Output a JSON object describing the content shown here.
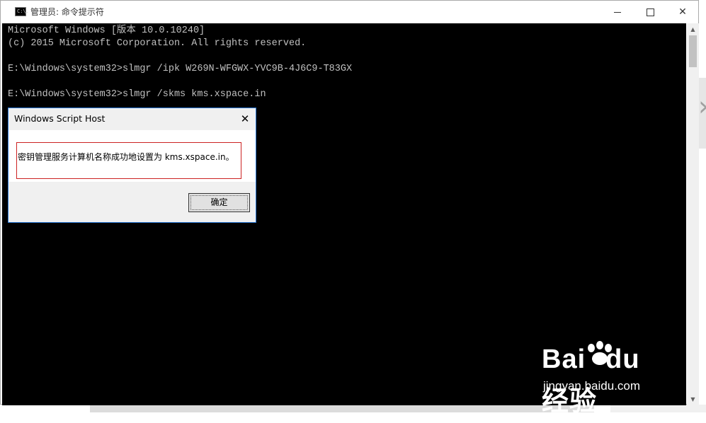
{
  "window": {
    "title": "管理员: 命令提示符",
    "icon_text": "C:\\.",
    "controls": {
      "minimize": "minimize",
      "maximize": "maximize",
      "close": "✕"
    }
  },
  "console": {
    "lines": [
      "Microsoft Windows [版本 10.0.10240]",
      "(c) 2015 Microsoft Corporation. All rights reserved.",
      "",
      "E:\\Windows\\system32>slmgr /ipk W269N-WFGWX-YVC9B-4J6C9-T83GX",
      "",
      "E:\\Windows\\system32>slmgr /skms kms.xspace.in"
    ]
  },
  "scrollbar": {
    "up": "▲",
    "down": "▼"
  },
  "dialog": {
    "title": "Windows Script Host",
    "close": "✕",
    "message": "密钥管理服务计算机名称成功地设置为 kms.xspace.in。",
    "ok_label": "确定",
    "highlight_color": "#cc2222"
  },
  "watermark": {
    "logo_text": "Bai du 经验",
    "url": "jingyan.baidu.com"
  },
  "colors": {
    "console_bg": "#000000",
    "console_text": "#c0c0c0",
    "dialog_border": "#2b79d6"
  }
}
